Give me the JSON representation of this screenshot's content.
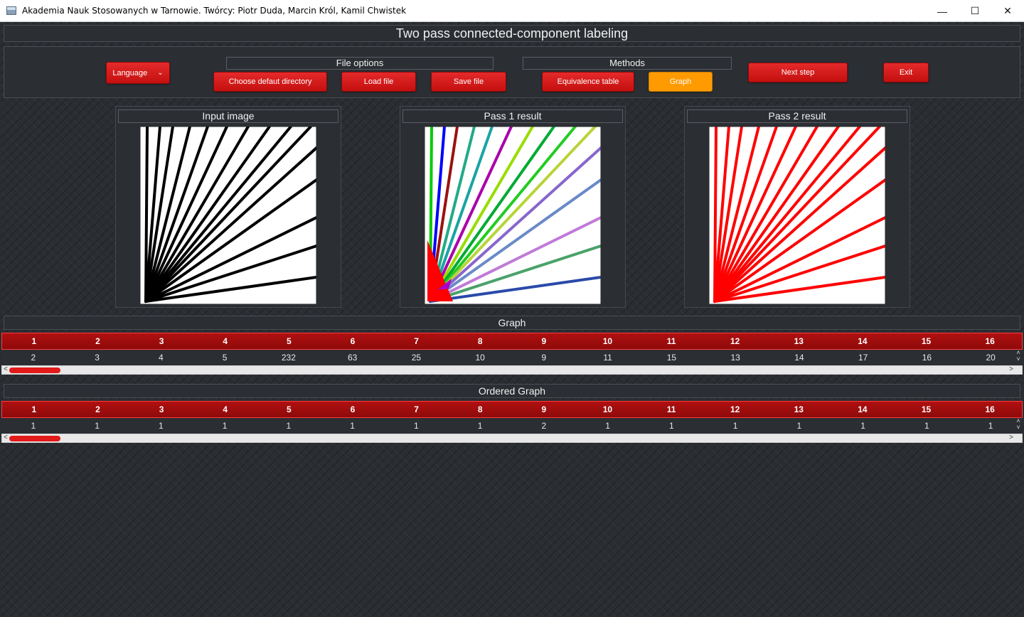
{
  "window": {
    "title": "Akademia Nauk Stosowanych w Tarnowie. Twórcy: Piotr Duda, Marcin Król, Kamil Chwistek",
    "minimize": "—",
    "maximize": "☐",
    "close": "✕"
  },
  "header": {
    "title": "Two pass connected-component labeling"
  },
  "toolbar": {
    "language_label": "Language",
    "file_options_label": "File options",
    "methods_label": "Methods",
    "choose_dir_label": "Choose defaut directory",
    "load_file_label": "Load file",
    "save_file_label": "Save file",
    "equivalence_table_label": "Equivalence table",
    "graph_label": "Graph",
    "next_step_label": "Next step",
    "exit_label": "Exit",
    "active_method": "Graph",
    "accent_color": "#d41515",
    "active_color": "#ff9a00"
  },
  "panels": {
    "input_title": "Input image",
    "pass1_title": "Pass 1 result",
    "pass2_title": "Pass 2 result"
  },
  "graph": {
    "title": "Graph",
    "columns": [
      "1",
      "2",
      "3",
      "4",
      "5",
      "6",
      "7",
      "8",
      "9",
      "10",
      "11",
      "12",
      "13",
      "14",
      "15",
      "16"
    ],
    "values": [
      "2",
      "3",
      "4",
      "5",
      "232",
      "63",
      "25",
      "10",
      "9",
      "11",
      "15",
      "13",
      "14",
      "17",
      "16",
      "20"
    ]
  },
  "ordered_graph": {
    "title": "Ordered Graph",
    "columns": [
      "1",
      "2",
      "3",
      "4",
      "5",
      "6",
      "7",
      "8",
      "9",
      "10",
      "11",
      "12",
      "13",
      "14",
      "15",
      "16"
    ],
    "values": [
      "1",
      "1",
      "1",
      "1",
      "1",
      "1",
      "1",
      "1",
      "2",
      "1",
      "1",
      "1",
      "1",
      "1",
      "1",
      "1"
    ]
  },
  "scroll_arrows": {
    "up": "˄",
    "down": "˅",
    "left": "<",
    "right": ">"
  }
}
